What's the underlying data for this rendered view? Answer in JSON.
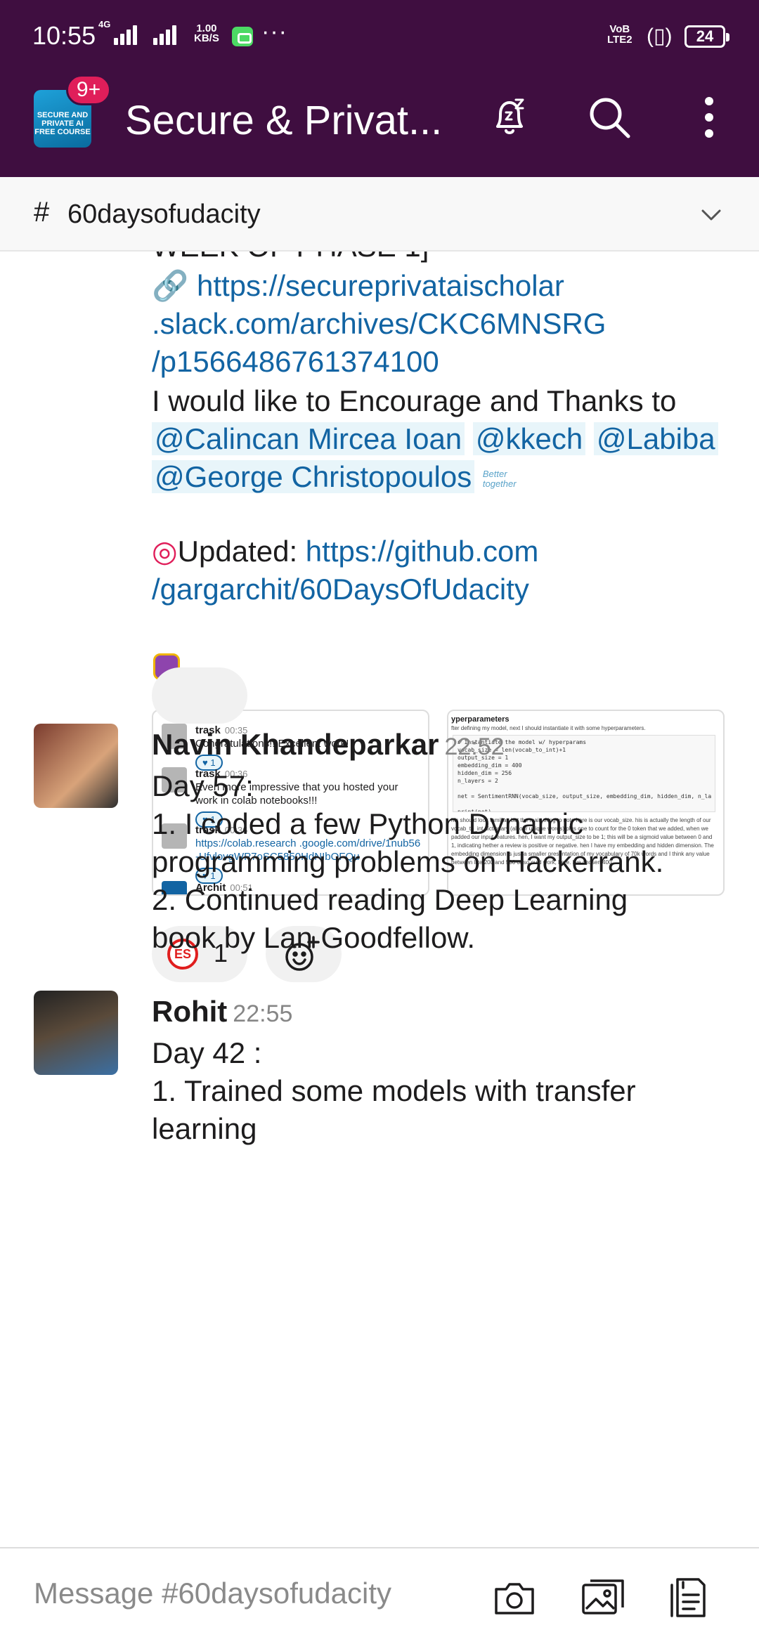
{
  "status_bar": {
    "time": "10:55",
    "network_label": "4G",
    "speed_line1": "1.00",
    "speed_line2": "KB/S",
    "volte_line1": "VoB",
    "volte_line2": "LTE2",
    "battery": "24"
  },
  "header": {
    "workspace_icon_text": "SECURE AND PRIVATE AI FREE COURSE",
    "notification_badge": "9+",
    "workspace_name": "Secure & Privat...",
    "icons": [
      "snooze-bell-icon",
      "search-icon",
      "more-vertical-icon"
    ]
  },
  "channel": {
    "hash": "#",
    "name": "60daysofudacity",
    "chevron": "chevron-down-icon"
  },
  "messages": {
    "partial": {
      "cut_line": "WEEK OF PHASE 1]",
      "link": "https://secureprivataischolar .slack.com/archives/CKC6MNSRG /p1566486761374100",
      "encourage": "I would like to Encourage and Thanks to",
      "mentions": [
        "@Calincan Mircea Ioan",
        "@kkech",
        "@Labiba",
        "@George Christopoulos"
      ],
      "emoji_text": "Better together",
      "updated_label": "Updated:",
      "updated_link": "https://github.com /gargarchit/60DaysOfUdacity",
      "thumb1": {
        "rows": [
          {
            "name": "trask",
            "time": "00:35",
            "text": "Congratulations!! Excellent work!",
            "react": "1"
          },
          {
            "name": "trask",
            "time": "00:36",
            "text": "Even more impressive that you hosted your work in colab notebooks!!!",
            "react": "1"
          },
          {
            "name": "trask",
            "time": "00:36",
            "text": "https://colab.research .google.com/drive/1nub56 -UfvlovgWP7oSC5850HdNIbOFQu",
            "react": "1"
          },
          {
            "name": "Archit",
            "time": "00:51",
            "text": ""
          }
        ]
      },
      "thumb2": {
        "heading": "yperparameters",
        "intro": "fter defining my model, next I should instantiate it with some hyperparameters.",
        "code": "# Instantiate the model w/ hyperparams\nvocab_size = len(vocab_to_int)+1\noutput_size = 1\nembedding_dim = 400\nhidden_dim = 256\nn_layers = 2\n\nnet = SentimentRNN(vocab_size, output_size, embedding_dim, hidden_dim, n_la\n\nprint(net)",
        "body": "his should look familiar, but the main thing to note here is our vocab_size. his is actually the length of our vocab_to_int dictionary (all our unique words) plus one to count for the 0 token that we added, when we padded our input features. hen, I want my output_size to be 1; this will be a sigmoid value between 0 and 1, indicating hether a review is positive or negative. hen I have my embedding and hidden dimension. The embedding dimension is just a smaller presentation of my vocabulary of 70k words and I think any value between like 200 and 500 or so ould work, here. I've chosen 400."
      },
      "reaction_count": "1",
      "reaction_emoji": "ES"
    },
    "items": [
      {
        "sender": "Navin Khandeparkar",
        "time": "22:52",
        "lines": [
          "Day 57:",
          "1. I coded a few Python Dynamic",
          "programming problems on Hackerrank.",
          "2. Continued reading Deep Learning",
          "book by Lan Goodfellow."
        ]
      },
      {
        "sender": "Rohit",
        "time": "22:55",
        "lines": [
          "Day 42 :",
          "1. Trained some models with transfer",
          "learning"
        ]
      }
    ]
  },
  "composer": {
    "placeholder": "Message #60daysofudacity",
    "icons": [
      "camera-icon",
      "gallery-icon",
      "files-icon"
    ]
  }
}
